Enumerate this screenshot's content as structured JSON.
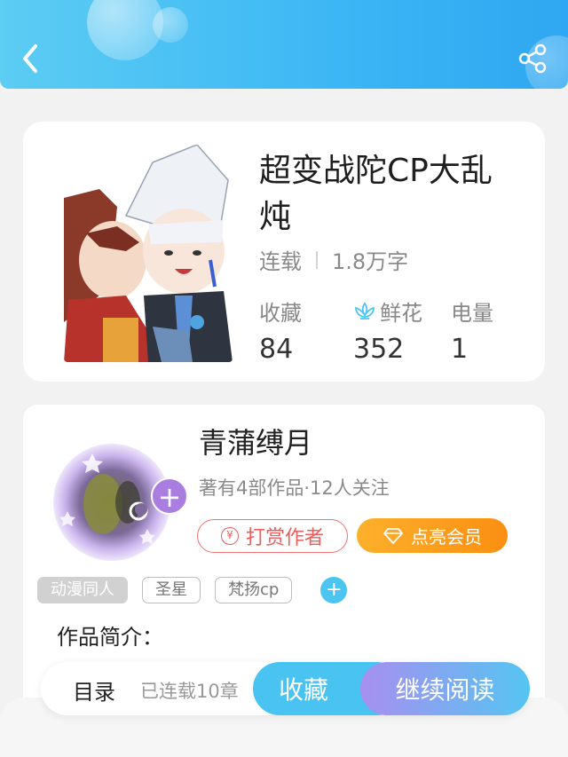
{
  "book": {
    "title": "超变战陀CP大乱炖",
    "status": "连载",
    "word_count": "1.8万字",
    "stats": [
      {
        "label": "收藏",
        "value": "84"
      },
      {
        "label": "鲜花",
        "value": "352"
      },
      {
        "label": "电量",
        "value": "1"
      }
    ]
  },
  "author": {
    "name": "青蒲缚月",
    "stats": "著有4部作品·12人关注",
    "follow_symbol": "+",
    "tip_label": "打赏作者",
    "tip_symbol": "¥",
    "vip_label": "点亮会员"
  },
  "tags": [
    {
      "label": "动漫同人"
    },
    {
      "label": "圣星"
    },
    {
      "label": "梵扬cp"
    }
  ],
  "tag_add_symbol": "+",
  "intro_label": "作品简介：",
  "toc": {
    "label": "目录",
    "status": "已连载10章"
  },
  "actions": {
    "collect_label": "收藏",
    "read_label": "继续阅读"
  },
  "colors": {
    "header": "#3cb6f4",
    "accent_blue": "#49c3f1",
    "tip_red": "#ef5c5c",
    "vip_orange": "#fb8f12",
    "read_purple": "#a78ff0"
  },
  "icons": {
    "back": "back-arrow-icon",
    "share": "share-icon",
    "flower": "lotus-flower-icon",
    "vip": "diamond-icon"
  }
}
